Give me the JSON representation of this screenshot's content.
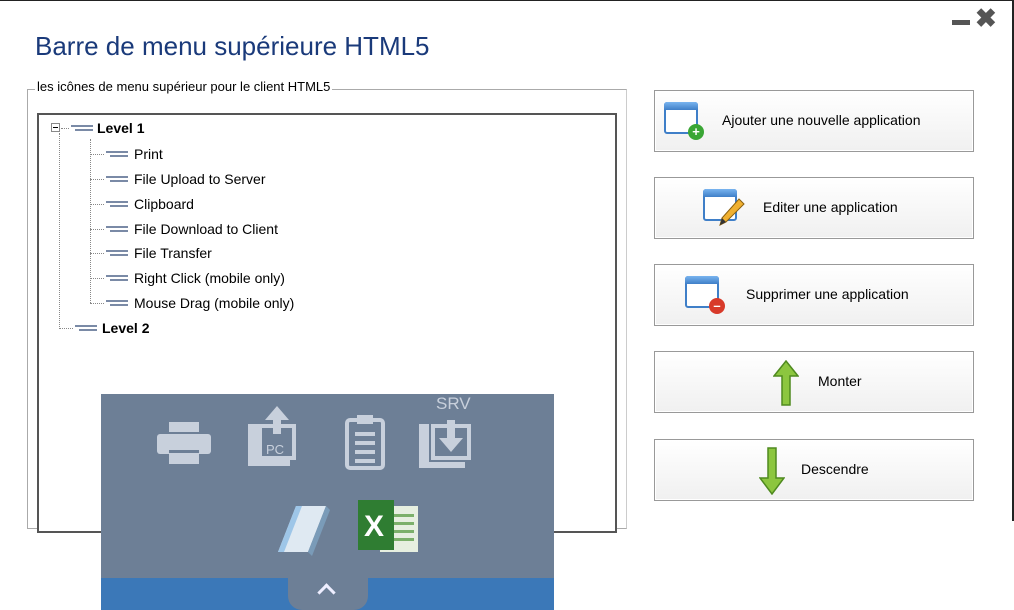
{
  "window": {
    "title": "Barre de menu supérieure HTML5",
    "minimize_icon": "minimize-icon",
    "close_icon": "close-icon"
  },
  "group": {
    "legend": "les icônes de menu supérieur pour le client HTML5"
  },
  "tree": {
    "level1": {
      "label": "Level 1",
      "expanded": true
    },
    "items": [
      {
        "label": "Print"
      },
      {
        "label": "File Upload to Server"
      },
      {
        "label": "Clipboard"
      },
      {
        "label": "File Download to Client"
      },
      {
        "label": "File Transfer"
      },
      {
        "label": "Right Click (mobile only)"
      },
      {
        "label": "Mouse Drag (mobile only)"
      }
    ],
    "level2": {
      "label": "Level 2"
    }
  },
  "buttons": {
    "add": {
      "label": "Ajouter une nouvelle application",
      "icon": "window-add-icon"
    },
    "edit": {
      "label": "Editer une application",
      "icon": "window-edit-icon"
    },
    "delete": {
      "label": "Supprimer une application",
      "icon": "window-delete-icon"
    },
    "up": {
      "label": "Monter",
      "icon": "arrow-up-icon"
    },
    "down": {
      "label": "Descendre",
      "icon": "arrow-down-icon"
    }
  },
  "toolbar_preview": {
    "srv_label": "SRV",
    "pc_label": "PC",
    "icons": [
      "printer-icon",
      "upload-pc-icon",
      "clipboard-icon",
      "download-srv-icon",
      "notepad-icon",
      "excel-icon",
      "chevron-up-icon"
    ]
  },
  "colors": {
    "title": "#1a3a7a",
    "preview_bg": "#6d7f96",
    "preview_bar": "#3b78b8",
    "arrow_green": "#8cc63f"
  }
}
